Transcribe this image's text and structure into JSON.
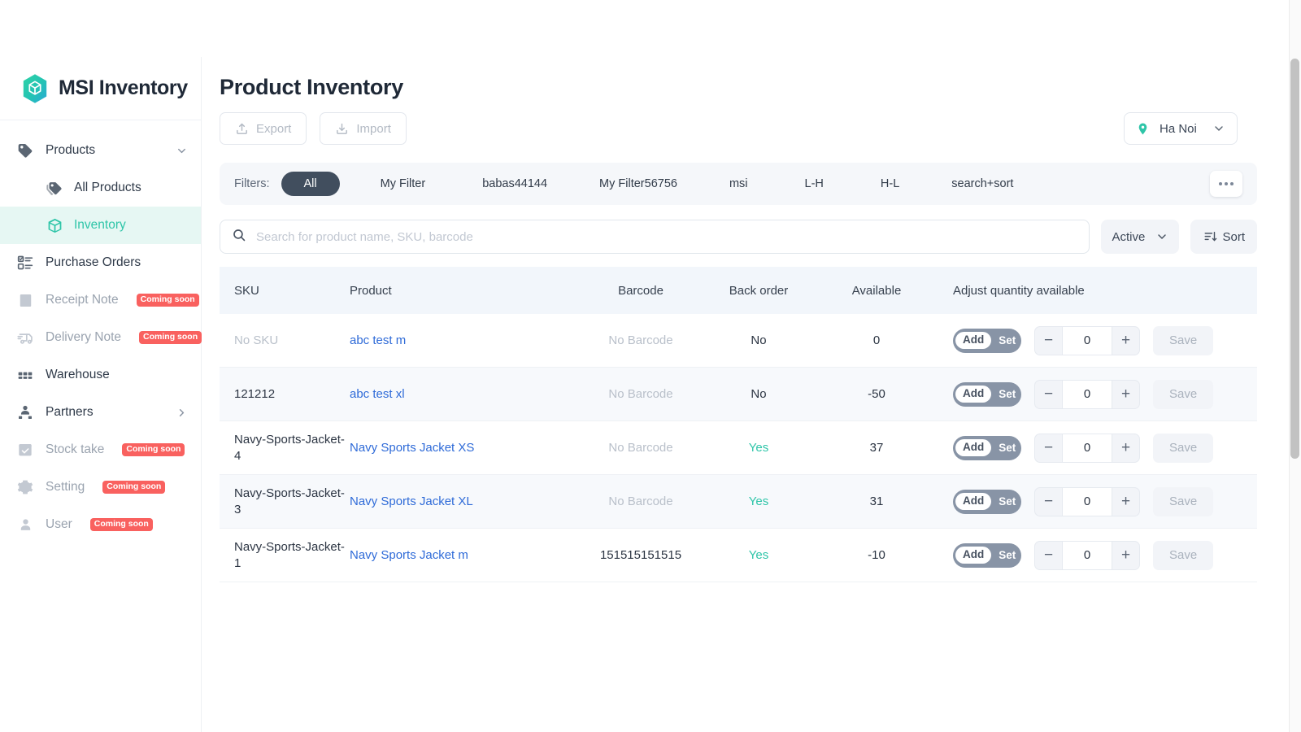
{
  "brand": {
    "name": "MSI Inventory",
    "logo_icon": "cube-hexagon-logo"
  },
  "sidebar": {
    "items": [
      {
        "label": "Products",
        "icon": "tag-icon",
        "state": "normal",
        "chevron": "chevron-down",
        "badge": ""
      },
      {
        "label": "All Products",
        "icon": "tags-icon",
        "state": "sub",
        "chevron": "",
        "badge": ""
      },
      {
        "label": "Inventory",
        "icon": "box-icon",
        "state": "active",
        "chevron": "",
        "badge": ""
      },
      {
        "label": "Purchase Orders",
        "icon": "clipboard-list-icon",
        "state": "normal",
        "chevron": "",
        "badge": ""
      },
      {
        "label": "Receipt Note",
        "icon": "receipt-icon",
        "state": "muted",
        "chevron": "",
        "badge": "Coming soon"
      },
      {
        "label": "Delivery Note",
        "icon": "truck-icon",
        "state": "muted",
        "chevron": "",
        "badge": "Coming soon"
      },
      {
        "label": "Warehouse",
        "icon": "warehouse-icon",
        "state": "normal",
        "chevron": "",
        "badge": ""
      },
      {
        "label": "Partners",
        "icon": "user-group-icon",
        "state": "normal",
        "chevron": "chevron-right",
        "badge": ""
      },
      {
        "label": "Stock take",
        "icon": "calendar-check-icon",
        "state": "muted",
        "chevron": "",
        "badge": "Coming soon"
      },
      {
        "label": "Setting",
        "icon": "gear-icon",
        "state": "muted",
        "chevron": "",
        "badge": "Coming soon"
      },
      {
        "label": "User",
        "icon": "user-icon",
        "state": "muted",
        "chevron": "",
        "badge": "Coming soon"
      }
    ]
  },
  "header": {
    "title": "Product Inventory",
    "export_label": "Export",
    "import_label": "Import",
    "location": {
      "value": "Ha Noi",
      "icon": "location-pin-icon"
    }
  },
  "filters": {
    "label": "Filters:",
    "items": [
      {
        "label": "All",
        "active": true
      },
      {
        "label": "My Filter",
        "active": false
      },
      {
        "label": "babas44144",
        "active": false
      },
      {
        "label": "My Filter56756",
        "active": false
      },
      {
        "label": "msi",
        "active": false
      },
      {
        "label": "L-H",
        "active": false
      },
      {
        "label": "H-L",
        "active": false
      },
      {
        "label": "search+sort",
        "active": false
      }
    ],
    "more_icon": "ellipsis-icon"
  },
  "search": {
    "placeholder": "Search for product name, SKU, barcode",
    "value": "",
    "icon": "search-icon",
    "status_filter": "Active",
    "sort_label": "Sort",
    "sort_icon": "sort-icon"
  },
  "table": {
    "columns": [
      "SKU",
      "Product",
      "Barcode",
      "Back order",
      "Available",
      "Adjust quantity available"
    ],
    "toggle": {
      "add_label": "Add",
      "set_label": "Set",
      "selected": "Add"
    },
    "save_label": "Save",
    "minus_label": "−",
    "plus_label": "+",
    "rows": [
      {
        "sku": "No SKU",
        "sku_muted": true,
        "product": "abc test m",
        "barcode": "No Barcode",
        "barcode_muted": true,
        "backorder": "No",
        "backorder_yes": false,
        "available": "0",
        "qty": "0"
      },
      {
        "sku": "121212",
        "sku_muted": false,
        "product": "abc test xl",
        "barcode": "No Barcode",
        "barcode_muted": true,
        "backorder": "No",
        "backorder_yes": false,
        "available": "-50",
        "qty": "0"
      },
      {
        "sku": "Navy-Sports-Jacket-4",
        "sku_muted": false,
        "product": "Navy Sports Jacket XS",
        "barcode": "No Barcode",
        "barcode_muted": true,
        "backorder": "Yes",
        "backorder_yes": true,
        "available": "37",
        "qty": "0"
      },
      {
        "sku": "Navy-Sports-Jacket-3",
        "sku_muted": false,
        "product": "Navy Sports Jacket XL",
        "barcode": "No Barcode",
        "barcode_muted": true,
        "backorder": "Yes",
        "backorder_yes": true,
        "available": "31",
        "qty": "0"
      },
      {
        "sku": "Navy-Sports-Jacket-1",
        "sku_muted": false,
        "product": "Navy Sports Jacket m",
        "barcode": "151515151515",
        "barcode_muted": false,
        "backorder": "Yes",
        "backorder_yes": true,
        "available": "-10",
        "qty": "0"
      }
    ]
  },
  "colors": {
    "accent_teal": "#2ec5a8",
    "dark_slate": "#414e5e",
    "toggle_slate": "#8894a6",
    "link_blue": "#2f6bd8",
    "badge_red": "#f9615f",
    "row_alt": "#f7f9fc",
    "header_bg": "#f2f6fb"
  }
}
